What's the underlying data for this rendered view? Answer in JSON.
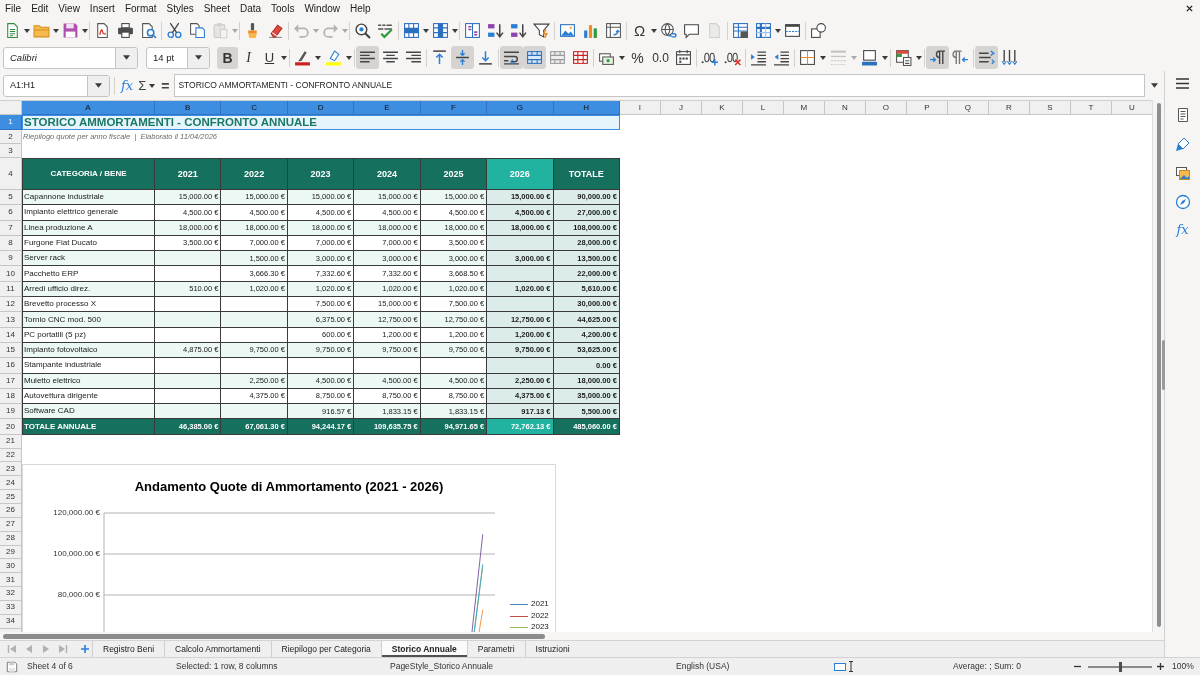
{
  "menu_bar": [
    "File",
    "Edit",
    "View",
    "Insert",
    "Format",
    "Styles",
    "Sheet",
    "Data",
    "Tools",
    "Window",
    "Help"
  ],
  "standard_toolbar": [
    [
      {
        "kind": "new",
        "disabled": false
      },
      {
        "kind": "open",
        "disabled": false
      },
      {
        "kind": "save",
        "disabled": false
      }
    ],
    [
      {
        "kind": "pdf",
        "disabled": false
      },
      {
        "kind": "print",
        "disabled": false
      },
      {
        "kind": "preview",
        "disabled": false
      }
    ],
    [
      {
        "kind": "cut",
        "disabled": false
      },
      {
        "kind": "copy",
        "disabled": false
      },
      {
        "kind": "paste",
        "disabled": true
      }
    ],
    [
      {
        "kind": "clone",
        "disabled": false
      },
      {
        "kind": "clear",
        "disabled": false
      }
    ],
    [
      {
        "kind": "undo",
        "disabled": true
      },
      {
        "kind": "redo",
        "disabled": true
      }
    ],
    [
      {
        "kind": "find",
        "disabled": false
      },
      {
        "kind": "spelling",
        "disabled": false
      }
    ],
    [
      {
        "kind": "row",
        "disabled": false
      },
      {
        "kind": "column",
        "disabled": false
      }
    ],
    [
      {
        "kind": "sort",
        "disabled": false
      },
      {
        "kind": "sortasc",
        "disabled": false
      },
      {
        "kind": "sortdesc",
        "disabled": false
      },
      {
        "kind": "filter",
        "disabled": false
      }
    ],
    [
      {
        "kind": "image",
        "disabled": false
      },
      {
        "kind": "chart",
        "disabled": false
      },
      {
        "kind": "pivot",
        "disabled": false
      }
    ],
    [
      {
        "kind": "special",
        "label": "Ω",
        "disabled": false
      },
      {
        "kind": "link",
        "disabled": false
      },
      {
        "kind": "comment",
        "disabled": false
      },
      {
        "kind": "headerfooter",
        "disabled": true
      }
    ],
    [
      {
        "kind": "printarea",
        "disabled": false
      },
      {
        "kind": "freeze",
        "disabled": false
      },
      {
        "kind": "split",
        "disabled": false
      }
    ],
    [
      {
        "kind": "draw",
        "disabled": false
      }
    ]
  ],
  "formatting_toolbar": {
    "font_name": "Calibri",
    "font_size": "14 pt",
    "groups": [
      [
        {
          "kind": "bold",
          "label": "B",
          "pressed": true,
          "disabled": false
        },
        {
          "kind": "italic",
          "label": "I",
          "pressed": false,
          "disabled": false
        },
        {
          "kind": "underline",
          "label": "U",
          "pressed": false,
          "disabled": false
        }
      ],
      [
        {
          "kind": "fontcolor",
          "pressed": false,
          "disabled": false
        },
        {
          "kind": "highlight",
          "pressed": false,
          "disabled": false
        }
      ],
      [
        {
          "kind": "alignleft",
          "pressed": true,
          "disabled": false
        },
        {
          "kind": "aligncenter",
          "pressed": false,
          "disabled": false
        },
        {
          "kind": "alignright",
          "pressed": false,
          "disabled": false
        }
      ],
      [
        {
          "kind": "aligntop",
          "pressed": false,
          "disabled": false
        },
        {
          "kind": "alignmiddle",
          "pressed": true,
          "disabled": false
        },
        {
          "kind": "alignbottom",
          "pressed": false,
          "disabled": false
        }
      ],
      [
        {
          "kind": "wrap",
          "pressed": true,
          "disabled": false
        },
        {
          "kind": "mergecenter",
          "pressed": true,
          "disabled": false
        },
        {
          "kind": "merge",
          "pressed": false,
          "disabled": false
        },
        {
          "kind": "unmerge",
          "pressed": false,
          "disabled": false
        }
      ],
      [
        {
          "kind": "currency",
          "pressed": false,
          "disabled": false
        },
        {
          "kind": "percent",
          "label": "%",
          "pressed": false,
          "disabled": false
        },
        {
          "kind": "number",
          "label": "0.0",
          "pressed": false,
          "disabled": false
        },
        {
          "kind": "date",
          "pressed": false,
          "disabled": false
        }
      ],
      [
        {
          "kind": "adddecimal",
          "pressed": false,
          "disabled": false
        },
        {
          "kind": "deletedecimal",
          "pressed": false,
          "disabled": false
        }
      ],
      [
        {
          "kind": "indent",
          "pressed": false,
          "disabled": false
        },
        {
          "kind": "outdent",
          "pressed": false,
          "disabled": false
        }
      ],
      [
        {
          "kind": "borders",
          "pressed": false,
          "disabled": false
        },
        {
          "kind": "borderstyle",
          "pressed": false,
          "disabled": true
        },
        {
          "kind": "bordercolor",
          "pressed": false,
          "disabled": false
        }
      ],
      [
        {
          "kind": "conditional",
          "pressed": false,
          "disabled": false
        }
      ],
      [
        {
          "kind": "ltr",
          "pressed": true,
          "disabled": false
        },
        {
          "kind": "rtl",
          "pressed": false,
          "disabled": false
        }
      ],
      [
        {
          "kind": "textdirection",
          "pressed": true,
          "disabled": false
        },
        {
          "kind": "vertical",
          "pressed": false,
          "disabled": false
        }
      ]
    ]
  },
  "formula_bar": {
    "name_box": "A1:H1",
    "function_wizard": "fx",
    "sum": "Σ",
    "equals": "=",
    "content": "STORICO AMMORTAMENTI - CONFRONTO ANNUALE"
  },
  "sidebar": [
    {
      "kind": "properties"
    },
    {
      "kind": "styles"
    },
    {
      "kind": "gallery"
    },
    {
      "kind": "navigator"
    },
    {
      "kind": "functions",
      "label": "fx"
    }
  ],
  "sheet": {
    "column_headers": [
      {
        "label": "A",
        "selected": true
      },
      {
        "label": "B",
        "selected": true
      },
      {
        "label": "C",
        "selected": true
      },
      {
        "label": "D",
        "selected": true
      },
      {
        "label": "E",
        "selected": true
      },
      {
        "label": "F",
        "selected": true
      },
      {
        "label": "G",
        "selected": true
      },
      {
        "label": "H",
        "selected": true
      },
      {
        "label": "I",
        "selected": false
      },
      {
        "label": "J",
        "selected": false
      },
      {
        "label": "K",
        "selected": false
      },
      {
        "label": "L",
        "selected": false
      },
      {
        "label": "M",
        "selected": false
      },
      {
        "label": "N",
        "selected": false
      },
      {
        "label": "O",
        "selected": false
      },
      {
        "label": "P",
        "selected": false
      },
      {
        "label": "Q",
        "selected": false
      },
      {
        "label": "R",
        "selected": false
      },
      {
        "label": "S",
        "selected": false
      },
      {
        "label": "T",
        "selected": false
      },
      {
        "label": "U",
        "selected": false
      }
    ],
    "row_headers": [
      {
        "label": "1",
        "selected": true
      },
      {
        "label": "2",
        "selected": false
      },
      {
        "label": "3",
        "selected": false
      },
      {
        "label": "4",
        "selected": false
      },
      {
        "label": "5",
        "selected": false
      },
      {
        "label": "6",
        "selected": false
      },
      {
        "label": "7",
        "selected": false
      },
      {
        "label": "8",
        "selected": false
      },
      {
        "label": "9",
        "selected": false
      },
      {
        "label": "10",
        "selected": false
      },
      {
        "label": "11",
        "selected": false
      },
      {
        "label": "12",
        "selected": false
      },
      {
        "label": "13",
        "selected": false
      },
      {
        "label": "14",
        "selected": false
      },
      {
        "label": "15",
        "selected": false
      },
      {
        "label": "16",
        "selected": false
      },
      {
        "label": "17",
        "selected": false
      },
      {
        "label": "18",
        "selected": false
      },
      {
        "label": "19",
        "selected": false
      },
      {
        "label": "20",
        "selected": false
      },
      {
        "label": "21",
        "selected": false
      },
      {
        "label": "22",
        "selected": false
      },
      {
        "label": "23",
        "selected": false
      },
      {
        "label": "24",
        "selected": false
      },
      {
        "label": "25",
        "selected": false
      },
      {
        "label": "26",
        "selected": false
      },
      {
        "label": "27",
        "selected": false
      },
      {
        "label": "28",
        "selected": false
      },
      {
        "label": "29",
        "selected": false
      },
      {
        "label": "30",
        "selected": false
      },
      {
        "label": "31",
        "selected": false
      },
      {
        "label": "32",
        "selected": false
      },
      {
        "label": "33",
        "selected": false
      },
      {
        "label": "34",
        "selected": false
      }
    ],
    "title": "STORICO AMMORTAMENTI - CONFRONTO ANNUALE",
    "subtitle": "Riepilogo quote per anno fiscale  |  Elaborato il 11/04/2026",
    "table": {
      "columns": [
        {
          "label": "CATEGORIA / BENE",
          "bold": false,
          "highlighted": false
        },
        {
          "label": "2021",
          "bold": false,
          "highlighted": false
        },
        {
          "label": "2022",
          "bold": false,
          "highlighted": false
        },
        {
          "label": "2023",
          "bold": false,
          "highlighted": false
        },
        {
          "label": "2024",
          "bold": false,
          "highlighted": false
        },
        {
          "label": "2025",
          "bold": false,
          "highlighted": false
        },
        {
          "label": "2026",
          "bold": true,
          "highlighted": true
        },
        {
          "label": "TOTALE",
          "bold": true,
          "highlighted": false
        }
      ],
      "rows": [
        [
          "Capannone industriale",
          "15,000.00 €",
          "15,000.00 €",
          "15,000.00 €",
          "15,000.00 €",
          "15,000.00 €",
          "15,000.00 €",
          "90,000.00 €"
        ],
        [
          "Impianto elettrico generale",
          "4,500.00 €",
          "4,500.00 €",
          "4,500.00 €",
          "4,500.00 €",
          "4,500.00 €",
          "4,500.00 €",
          "27,000.00 €"
        ],
        [
          "Linea produzione A",
          "18,000.00 €",
          "18,000.00 €",
          "18,000.00 €",
          "18,000.00 €",
          "18,000.00 €",
          "18,000.00 €",
          "108,000.00 €"
        ],
        [
          "Furgone Fiat Ducato",
          "3,500.00 €",
          "7,000.00 €",
          "7,000.00 €",
          "7,000.00 €",
          "3,500.00 €",
          null,
          "28,000.00 €"
        ],
        [
          "Server rack",
          null,
          "1,500.00 €",
          "3,000.00 €",
          "3,000.00 €",
          "3,000.00 €",
          "3,000.00 €",
          "13,500.00 €"
        ],
        [
          "Pacchetto ERP",
          null,
          "3,666.30 €",
          "7,332.60 €",
          "7,332.60 €",
          "3,668.50 €",
          null,
          "22,000.00 €"
        ],
        [
          "Arredi ufficio direz.",
          "510.00 €",
          "1,020.00 €",
          "1,020.00 €",
          "1,020.00 €",
          "1,020.00 €",
          "1,020.00 €",
          "5,610.00 €"
        ],
        [
          "Brevetto processo X",
          null,
          null,
          "7,500.00 €",
          "15,000.00 €",
          "7,500.00 €",
          null,
          "30,000.00 €"
        ],
        [
          "Tornio CNC mod. 500",
          null,
          null,
          "6,375.00 €",
          "12,750.00 €",
          "12,750.00 €",
          "12,750.00 €",
          "44,625.00 €"
        ],
        [
          "PC portatili (5 pz)",
          null,
          null,
          "600.00 €",
          "1,200.00 €",
          "1,200.00 €",
          "1,200.00 €",
          "4,200.00 €"
        ],
        [
          "Impianto fotovoltaico",
          "4,875.00 €",
          "9,750.00 €",
          "9,750.00 €",
          "9,750.00 €",
          "9,750.00 €",
          "9,750.00 €",
          "53,625.00 €"
        ],
        [
          "Stampante industriale",
          null,
          null,
          null,
          null,
          null,
          null,
          "0.00 €"
        ],
        [
          "Muletto elettrico",
          null,
          "2,250.00 €",
          "4,500.00 €",
          "4,500.00 €",
          "4,500.00 €",
          "2,250.00 €",
          "18,000.00 €"
        ],
        [
          "Autovettura dirigente",
          null,
          "4,375.00 €",
          "8,750.00 €",
          "8,750.00 €",
          "8,750.00 €",
          "4,375.00 €",
          "35,000.00 €"
        ],
        [
          "Software CAD",
          null,
          null,
          "916.57 €",
          "1,833.15 €",
          "1,833.15 €",
          "917.13 €",
          "5,500.00 €"
        ]
      ],
      "total": [
        "TOTALE ANNUALE",
        "46,385.00 €",
        "67,061.30 €",
        "94,244.17 €",
        "109,635.75 €",
        "94,971.65 €",
        "72,762.13 €",
        "485,060.00 €"
      ]
    },
    "chart": {
      "title": "Andamento Quote di Ammortamento (2021 - 2026)",
      "axis_labels": [
        "120,000.00 €",
        "100,000.00 €",
        "80,000.00 €"
      ],
      "legend": [
        {
          "label": "2021",
          "color": "#4f81bd"
        },
        {
          "label": "2022",
          "color": "#c0504d"
        },
        {
          "label": "2023",
          "color": "#9bbb59"
        }
      ]
    }
  },
  "sheet_tabs": {
    "navigation_disabled": true,
    "tabs": [
      {
        "label": "Registro Beni",
        "selected": false
      },
      {
        "label": "Calcolo Ammortamenti",
        "selected": false
      },
      {
        "label": "Riepilogo per Categoria",
        "selected": false
      },
      {
        "label": "Storico Annuale",
        "selected": true
      },
      {
        "label": "Parametri",
        "selected": false
      },
      {
        "label": "Istruzioni",
        "selected": false
      }
    ]
  },
  "status_bar": {
    "sheet_position": "Sheet 4 of 6",
    "selection": "Selected: 1 row, 8 columns",
    "page_style": "PageStyle_Storico Annuale",
    "language": "English (USA)",
    "summary": "Average: ; Sum: 0",
    "zoom_slider": {
      "level": 0.5
    },
    "zoom": "100%"
  }
}
